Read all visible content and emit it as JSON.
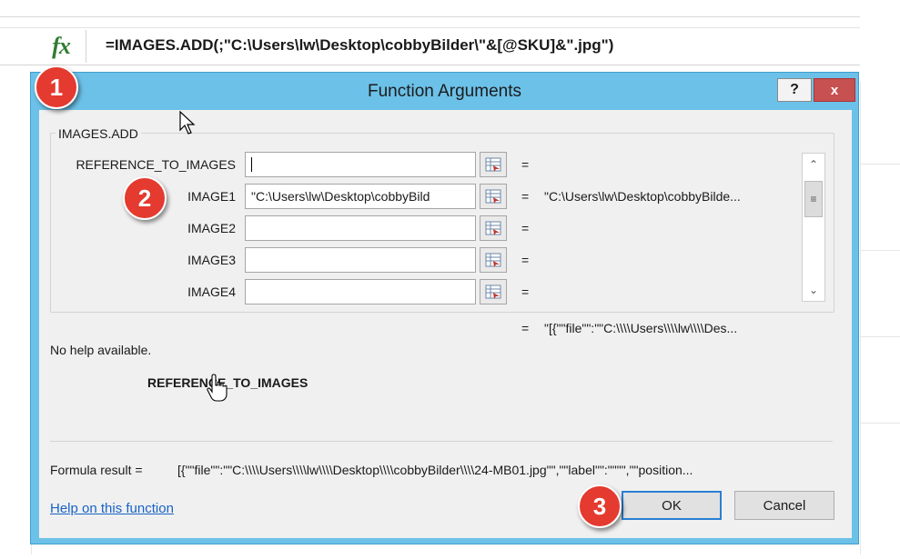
{
  "formula_bar": {
    "fx_icon": "fx",
    "formula": "=IMAGES.ADD(;\"C:\\Users\\lw\\Desktop\\cobbyBilder\\\"&[@SKU]&\".jpg\")"
  },
  "dialog": {
    "title": "Function Arguments",
    "help_button": "?",
    "close_button": "x",
    "function_name": "IMAGES.ADD",
    "arguments": [
      {
        "label": "REFERENCE_TO_IMAGES",
        "value": "",
        "result": ""
      },
      {
        "label": "IMAGE1",
        "value": "\"C:\\Users\\lw\\Desktop\\cobbyBild",
        "result": "\"C:\\Users\\lw\\Desktop\\cobbyBilde..."
      },
      {
        "label": "IMAGE2",
        "value": "",
        "result": ""
      },
      {
        "label": "IMAGE3",
        "value": "",
        "result": ""
      },
      {
        "label": "IMAGE4",
        "value": "",
        "result": ""
      }
    ],
    "equals": "=",
    "overall_result": "\"[{\"\"file\"\":\"\"C:\\\\\\\\Users\\\\\\\\lw\\\\\\\\Des...",
    "help_text": "No help available.",
    "help_arg_title": "REFERENCE_TO_IMAGES",
    "formula_result_label": "Formula result =",
    "formula_result_value": "[{\"\"file\"\":\"\"C:\\\\\\\\Users\\\\\\\\lw\\\\\\\\Desktop\\\\\\\\cobbyBilder\\\\\\\\24-MB01.jpg\"\",\"\"label\"\":\"\"\"\",\"\"position...",
    "help_link": "Help on this function",
    "ok_label": "OK",
    "cancel_label": "Cancel"
  },
  "badges": [
    "1",
    "2",
    "3"
  ],
  "colors": {
    "dialog_frame": "#6cc1e8",
    "badge": "#e43a2f",
    "close": "#c75050",
    "link": "#1863c7"
  }
}
